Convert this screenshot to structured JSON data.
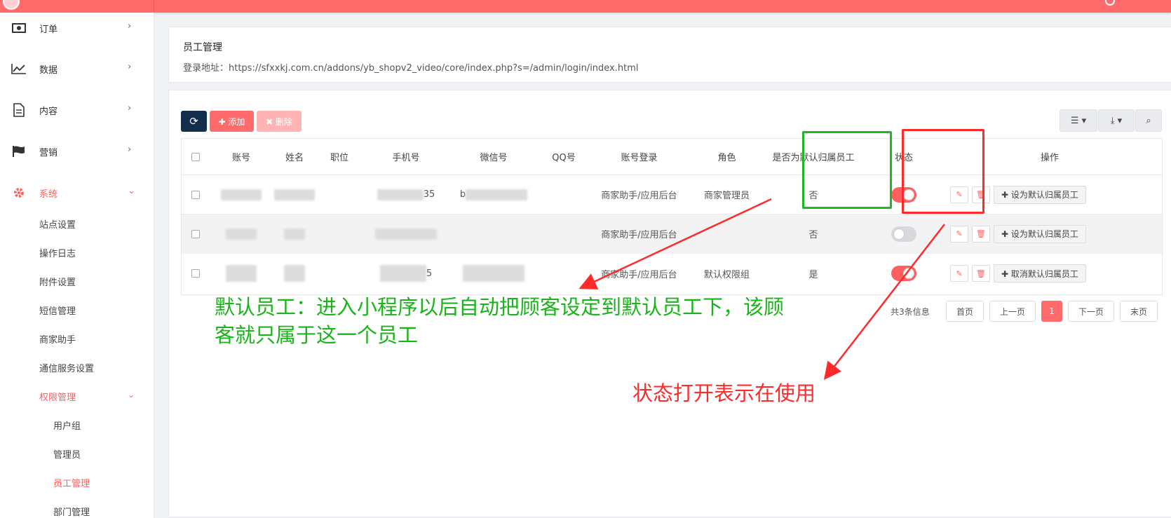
{
  "sidebar": {
    "nav": [
      {
        "label": "订单",
        "icon": "money-icon"
      },
      {
        "label": "数据",
        "icon": "chart-line-icon"
      },
      {
        "label": "内容",
        "icon": "document-icon"
      },
      {
        "label": "营销",
        "icon": "flag-icon"
      },
      {
        "label": "系统",
        "icon": "gear-icon"
      }
    ],
    "chevron": "›",
    "chevron_down": "⌄",
    "sub": [
      "站点设置",
      "操作日志",
      "附件设置",
      "短信管理",
      "商家助手",
      "通信服务设置"
    ],
    "group": "权限管理",
    "sub2": [
      "用户组",
      "管理员",
      "员工管理",
      "部门管理"
    ]
  },
  "page": {
    "title": "员工管理",
    "login_url": "登录地址：https://sfxxkj.com.cn/addons/yb_shopv2_video/core/index.php?s=/admin/login/index.html"
  },
  "toolbar": {
    "add_label": "✚ 添加",
    "delete_label": "✖ 删除"
  },
  "table": {
    "headers": [
      "账号",
      "姓名",
      "职位",
      "手机号",
      "微信号",
      "QQ号",
      "账号登录",
      "角色",
      "是否为默认归属员工",
      "状态",
      "操作"
    ],
    "rows": [
      {
        "phone_suffix": "35",
        "wechat_prefix": "b",
        "login": "商家助手/应用后台",
        "role": "商家管理员",
        "is_default": "否",
        "status_on": true,
        "action": "✚ 设为默认归属员工"
      },
      {
        "phone_suffix": "",
        "wechat_prefix": "",
        "login": "商家助手/应用后台",
        "role": "",
        "is_default": "否",
        "status_on": false,
        "action": "✚ 设为默认归属员工"
      },
      {
        "phone_suffix": "5",
        "wechat_prefix": "",
        "login": "商家助手/应用后台",
        "role": "默认权限组",
        "is_default": "是",
        "status_on": true,
        "action": "✚ 取消默认归属员工"
      }
    ]
  },
  "pagination": {
    "total": "共3条信息",
    "first": "首页",
    "prev": "上一页",
    "current": "1",
    "next": "下一页",
    "last": "末页"
  },
  "annotations": {
    "default_staff": "默认员工：进入小程序以后自动把顾客设定到默认员工下，该顾客就只属于这一个员工",
    "status": "状态打开表示在使用"
  },
  "colors": {
    "accent": "#ff6b6b",
    "annot_green": "#19b419",
    "annot_red": "#ff2b2b"
  }
}
